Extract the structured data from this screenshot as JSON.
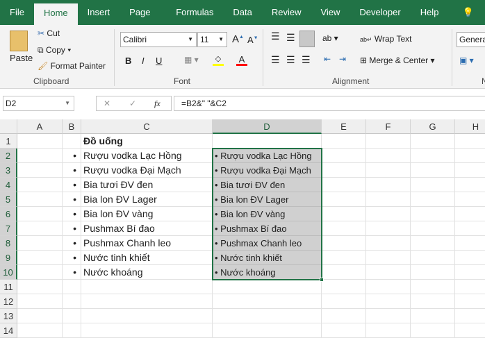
{
  "tabs": [
    "File",
    "Home",
    "Insert",
    "Page Layout",
    "Formulas",
    "Data",
    "Review",
    "View",
    "Developer",
    "Help",
    "Tell"
  ],
  "clipboard": {
    "paste": "Paste",
    "cut": "Cut",
    "copy": "Copy",
    "format_painter": "Format Painter",
    "label": "Clipboard"
  },
  "font": {
    "name": "Calibri",
    "size": "11",
    "bold": "B",
    "italic": "I",
    "underline": "U",
    "label": "Font",
    "fill_color": "#ffff00",
    "font_color": "#ff0000"
  },
  "alignment": {
    "wrap": "Wrap Text",
    "merge": "Merge & Center",
    "label": "Alignment"
  },
  "number": {
    "format": "General",
    "label": "N"
  },
  "formula_bar": {
    "name_box": "D2",
    "cancel": "✕",
    "enter": "✓",
    "fx": "fx",
    "formula": "=B2&\" \"&C2"
  },
  "columns": [
    "A",
    "B",
    "C",
    "D",
    "E",
    "F",
    "G",
    "H"
  ],
  "rows": [
    "1",
    "2",
    "3",
    "4",
    "5",
    "6",
    "7",
    "8",
    "9",
    "10",
    "11",
    "12",
    "13",
    "14"
  ],
  "header_c1": "Đồ uống",
  "bullets": [
    "•",
    "•",
    "•",
    "•",
    "•",
    "•",
    "•",
    "•",
    "•"
  ],
  "items": [
    "Rượu vodka Lạc Hồng",
    "Rượu vodka Đại Mạch",
    "Bia tươi ĐV đen",
    "Bia lon ĐV Lager",
    "Bia lon ĐV vàng",
    "Pushmax Bí đao",
    "Pushmax Chanh leo",
    "Nước tinh khiết",
    "Nước khoáng"
  ],
  "d_values": [
    "• Rượu vodka Lạc Hồng",
    "• Rượu vodka Đại Mạch",
    "• Bia tươi ĐV đen",
    "• Bia lon ĐV Lager",
    "• Bia lon ĐV vàng",
    "• Pushmax Bí đao",
    "• Pushmax Chanh leo",
    "• Nước tinh khiết",
    "• Nước khoáng"
  ]
}
